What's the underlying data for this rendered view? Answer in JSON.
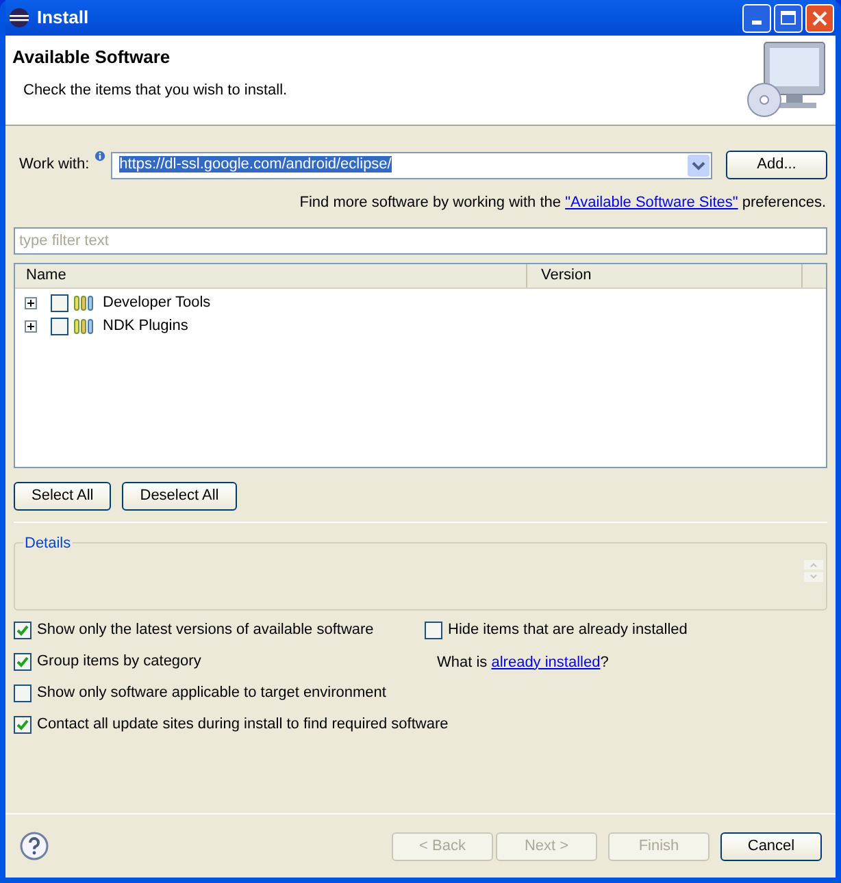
{
  "window": {
    "title": "Install"
  },
  "header": {
    "title": "Available Software",
    "description": "Check the items that you wish to install."
  },
  "work_with": {
    "label": "Work with:",
    "value": "https://dl-ssl.google.com/android/eclipse/",
    "button": "Add..."
  },
  "find_more": {
    "before": "Find more software by working with the ",
    "link": "\"Available Software Sites\"",
    "after": " preferences."
  },
  "filter": {
    "placeholder": "type filter text"
  },
  "tree": {
    "columns": [
      "Name",
      "Version"
    ],
    "rows": [
      {
        "name": "Developer Tools",
        "checked": false,
        "expanded": false
      },
      {
        "name": "NDK Plugins",
        "checked": false,
        "expanded": false
      }
    ]
  },
  "selection_buttons": [
    "Select All",
    "Deselect All"
  ],
  "details": {
    "title": "Details"
  },
  "options_left": [
    {
      "label": "Show only the latest versions of available software",
      "checked": true
    },
    {
      "label": "Group items by category",
      "checked": true
    },
    {
      "label": "Show only software applicable to target environment",
      "checked": false
    },
    {
      "label": "Contact all update sites during install to find required software",
      "checked": true
    }
  ],
  "options_right": [
    {
      "label": "Hide items that are already installed",
      "checked": false
    }
  ],
  "installed_hint": {
    "before": "What is ",
    "link": "already installed",
    "after": "?"
  },
  "footer": {
    "buttons": [
      {
        "label": "< Back",
        "disabled": true
      },
      {
        "label": "Next >",
        "disabled": true
      },
      {
        "label": "Finish",
        "disabled": true
      },
      {
        "label": "Cancel",
        "disabled": false
      }
    ]
  }
}
